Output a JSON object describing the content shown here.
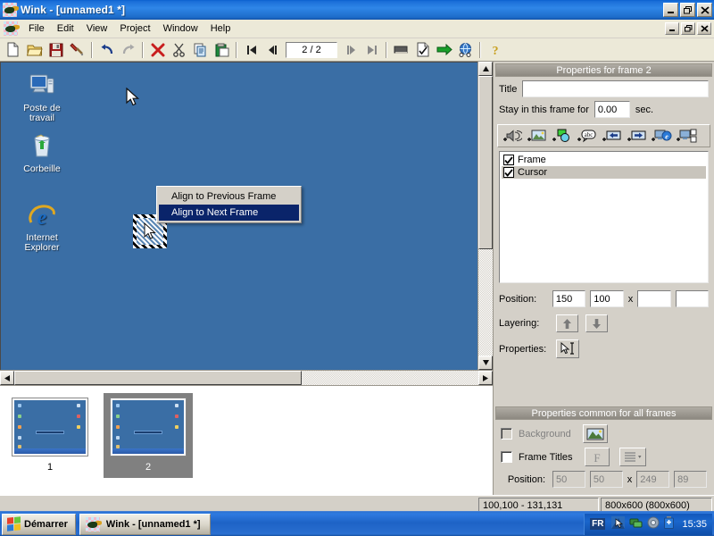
{
  "app": {
    "title": "Wink - [unnamed1 *]",
    "icon": "wink-frog-icon"
  },
  "window_controls": {
    "minimize": "minimize-icon",
    "restore": "restore-icon",
    "close": "close-icon"
  },
  "menubar": {
    "items": [
      {
        "label": "File"
      },
      {
        "label": "Edit"
      },
      {
        "label": "View"
      },
      {
        "label": "Project"
      },
      {
        "label": "Window"
      },
      {
        "label": "Help"
      }
    ]
  },
  "toolbar": {
    "page_counter": "2 / 2",
    "buttons": [
      {
        "name": "new-icon"
      },
      {
        "name": "open-icon"
      },
      {
        "name": "save-icon"
      },
      {
        "name": "build-hammer-icon"
      },
      {
        "name": "undo-icon"
      },
      {
        "name": "redo-icon"
      },
      {
        "name": "delete-icon"
      },
      {
        "name": "cut-icon"
      },
      {
        "name": "copy-icon"
      },
      {
        "name": "paste-icon"
      },
      {
        "name": "first-frame-icon"
      },
      {
        "name": "previous-frame-icon"
      },
      {
        "name": "next-frame-icon"
      },
      {
        "name": "last-frame-icon"
      },
      {
        "name": "render-icon"
      },
      {
        "name": "export-icon"
      },
      {
        "name": "play-icon"
      },
      {
        "name": "browser-preview-icon"
      },
      {
        "name": "help-icon"
      }
    ]
  },
  "canvas": {
    "desktop_icons": [
      {
        "label": "Poste de travail",
        "icon": "my-computer-icon"
      },
      {
        "label": "Corbeille",
        "icon": "recycle-bin-icon"
      },
      {
        "label": "Internet Explorer",
        "icon": "internet-explorer-icon"
      }
    ],
    "selected_object": "cursor-object"
  },
  "context_menu": {
    "items": [
      {
        "label": "Align to Previous Frame",
        "selected": false
      },
      {
        "label": "Align to Next Frame",
        "selected": true
      }
    ]
  },
  "frames": {
    "items": [
      {
        "number": "1",
        "selected": false
      },
      {
        "number": "2",
        "selected": true
      }
    ]
  },
  "properties_frame": {
    "header": "Properties for frame 2",
    "title_label": "Title",
    "title_value": "",
    "title_placeholder": "",
    "stay_label": "Stay in this frame for",
    "stay_value": "0.00",
    "stay_unit": "sec.",
    "object_buttons": [
      {
        "name": "add-sound-icon"
      },
      {
        "name": "add-image-icon"
      },
      {
        "name": "add-shape-icon"
      },
      {
        "name": "add-text-icon"
      },
      {
        "name": "add-previous-button-icon"
      },
      {
        "name": "add-next-button-icon"
      },
      {
        "name": "add-browser-link-icon"
      },
      {
        "name": "add-window-icon"
      }
    ],
    "objects": [
      {
        "label": "Frame",
        "checked": true,
        "selected": false
      },
      {
        "label": "Cursor",
        "checked": true,
        "selected": true
      }
    ],
    "position_label": "Position:",
    "position_x": "150",
    "position_y": "100",
    "position_sep": "x",
    "position_w": "",
    "position_h": "",
    "layering_label": "Layering:",
    "layer_up": "arrow-up-icon",
    "layer_down": "arrow-down-icon",
    "properties_label": "Properties:",
    "properties_icon": "cursor-properties-icon"
  },
  "properties_common": {
    "header": "Properties common for all frames",
    "background_label": "Background",
    "background_checked": false,
    "background_icon": "image-icon",
    "frame_titles_label": "Frame Titles",
    "frame_titles_checked": false,
    "font_icon": "font-F-icon",
    "align_icon": "align-lines-icon",
    "position_label": "Position:",
    "position_x": "50",
    "position_y": "50",
    "position_sep": "x",
    "position_w": "249",
    "position_h": "89"
  },
  "statusbar": {
    "coords": "100,100 - 131,131",
    "dimensions": "800x600 (800x600)"
  },
  "taskbar": {
    "start_label": "Démarrer",
    "task_label": "Wink - [unnamed1 *]",
    "lang": "FR",
    "tray_icons": [
      {
        "name": "display-properties-icon"
      },
      {
        "name": "network-icon"
      },
      {
        "name": "volume-icon"
      },
      {
        "name": "battery-icon"
      }
    ],
    "clock": "15:35"
  },
  "colors": {
    "desktop_blue": "#3a6ea5",
    "chrome": "#d4d0c8",
    "menu_bg": "#ece9d8",
    "title_blue": "#2f86e8",
    "selection": "#0a246a"
  }
}
